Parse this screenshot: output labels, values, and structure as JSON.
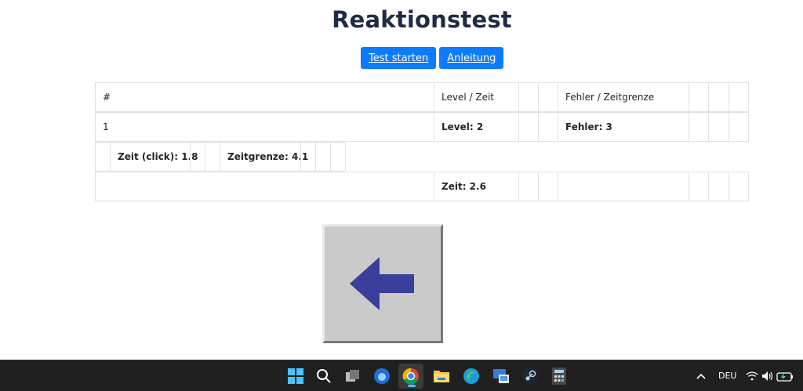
{
  "page": {
    "title": "Reaktionstest"
  },
  "buttons": {
    "start_label": "Test starten",
    "help_label": "Anleitung"
  },
  "table": {
    "header": {
      "num": "#",
      "level_time": "Level / Zeit",
      "error_limit": "Fehler / Zeitgrenze"
    },
    "row1": {
      "num": "1",
      "level": "Level: 2",
      "errors": "Fehler: 3"
    },
    "row2": {
      "click_time": "Zeit (click): 1.8",
      "time_limit": "Zeitgrenze: 4.1"
    },
    "row3": {
      "time": "Zeit: 2.6"
    }
  },
  "stimulus": {
    "arrow_direction": "left",
    "arrow_color": "#3a3f9c",
    "background_color": "#cacaca"
  },
  "taskbar": {
    "apps": [
      "start-icon",
      "search-icon",
      "task-view-icon",
      "thunderbird-icon",
      "chrome-icon",
      "file-explorer-icon",
      "edge-icon",
      "remote-desktop-icon",
      "steam-icon",
      "calculator-icon"
    ],
    "language": "DEU"
  }
}
